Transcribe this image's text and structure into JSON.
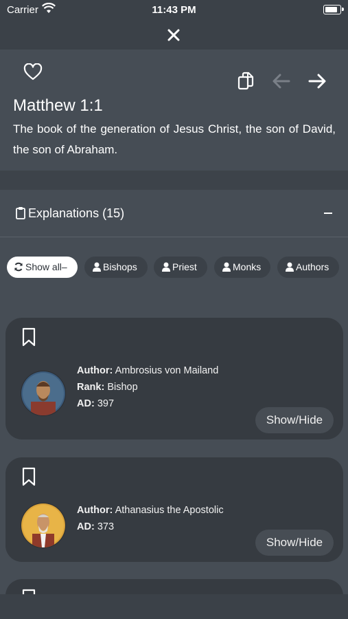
{
  "status_bar": {
    "carrier": "Carrier",
    "time": "11:43 PM"
  },
  "verse": {
    "reference": "Matthew 1:1",
    "text": "The book of the generation of Jesus Christ, the son of David, the son of Abraham."
  },
  "explanations": {
    "title": "Explanations (15)"
  },
  "filters": [
    {
      "label": "Show all–",
      "icon": "refresh-icon",
      "active": true
    },
    {
      "label": "Bishops",
      "icon": "person-icon"
    },
    {
      "label": "Priest",
      "icon": "person-icon"
    },
    {
      "label": "Monks",
      "icon": "person-icon"
    },
    {
      "label": "Authors",
      "icon": "person-icon"
    }
  ],
  "cards": [
    {
      "author_label": "Author:",
      "author": "Ambrosius von Mailand",
      "rank_label": "Rank:",
      "rank": "Bishop",
      "ad_label": "AD:",
      "ad": "397",
      "button": "Show/Hide"
    },
    {
      "author_label": "Author:",
      "author": "Athanasius the Apostolic",
      "ad_label": "AD:",
      "ad": "373",
      "button": "Show/Hide"
    }
  ],
  "colors": {
    "background": "#464d55",
    "card": "#363b41",
    "chip": "#3b4148"
  }
}
